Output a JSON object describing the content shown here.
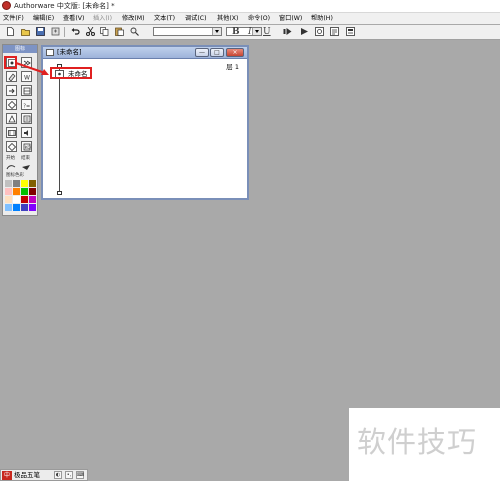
{
  "titlebar": {
    "title": "Authorware 中文版: [未命名] *"
  },
  "menubar": {
    "items": [
      {
        "label": "文件(F)",
        "enabled": true
      },
      {
        "label": "编辑(E)",
        "enabled": true
      },
      {
        "label": "查看(V)",
        "enabled": true
      },
      {
        "label": "插入(I)",
        "enabled": false
      },
      {
        "label": "修改(M)",
        "enabled": true
      },
      {
        "label": "文本(T)",
        "enabled": true
      },
      {
        "label": "调试(C)",
        "enabled": true
      },
      {
        "label": "其他(X)",
        "enabled": true
      },
      {
        "label": "命令(O)",
        "enabled": true
      },
      {
        "label": "窗口(W)",
        "enabled": true
      },
      {
        "label": "帮助(H)",
        "enabled": true
      }
    ]
  },
  "toolbar": {
    "font_value": "",
    "bold": "B",
    "italic": "I",
    "underline": "U"
  },
  "palette": {
    "title": "图标",
    "start_label": "开始",
    "end_label": "结束",
    "color_label": "图标色彩",
    "swatches": [
      "#c0c0c0",
      "#808080",
      "#ffff00",
      "#806000",
      "#ffc0c0",
      "#ff8000",
      "#00c000",
      "#800000",
      "#ffe0c0",
      "#ffffff",
      "#c00000",
      "#c000c0",
      "#80c0ff",
      "#0080ff",
      "#4040c0",
      "#8000ff"
    ]
  },
  "design_window": {
    "title": "[未命名]",
    "level": "层 1",
    "icon_label": "未命名",
    "minimize": "—",
    "maximize": "□",
    "close": "×"
  },
  "taskbar": {
    "ime_logo": "中",
    "ime_name": "极品五笔",
    "btn1": "◐",
    "btn2": "•,",
    "btn3": "⌨"
  },
  "watermark": {
    "text": "软件技巧"
  },
  "accent": {
    "annotation": "#e02020",
    "window_border": "#7a8fb8"
  }
}
